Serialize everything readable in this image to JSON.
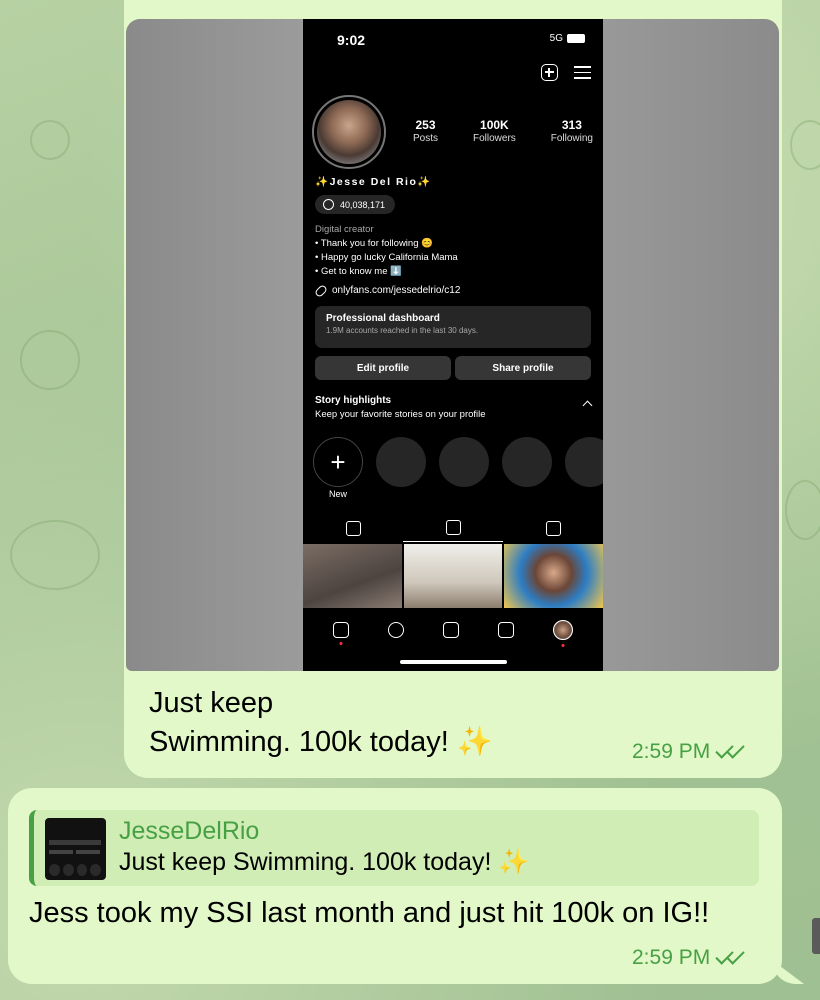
{
  "chat": {
    "message1": {
      "text_line1": "Just keep",
      "text_line2": "Swimming. 100k today! ✨",
      "time": "2:59 PM",
      "screenshot": {
        "status": {
          "time": "9:02",
          "network": "5G"
        },
        "profile": {
          "name": "✨Jesse Del Rio✨",
          "threads_count": "40,038,171",
          "stats": [
            {
              "value": "253",
              "label": "Posts"
            },
            {
              "value": "100K",
              "label": "Followers"
            },
            {
              "value": "313",
              "label": "Following"
            }
          ],
          "bio": {
            "category": "Digital creator",
            "lines": [
              "• Thank you for following 😊",
              "• Happy go lucky California Mama",
              "• Get to know me ⬇️"
            ]
          },
          "link": "onlyfans.com/jessedelrio/c12",
          "dashboard": {
            "title": "Professional dashboard",
            "subtitle": "1.9M accounts reached in the last 30 days."
          },
          "buttons": {
            "edit": "Edit profile",
            "share": "Share profile"
          },
          "highlights": {
            "title": "Story highlights",
            "subtitle": "Keep your favorite stories on your profile",
            "new_label": "New"
          }
        }
      }
    },
    "message2": {
      "reply": {
        "name": "JesseDelRio",
        "text": "Just keep Swimming. 100k today! ✨"
      },
      "text": "Jess took my SSI last month and just hit 100k on IG!!",
      "time": "2:59 PM"
    }
  },
  "colors": {
    "bubble": "#e2f8c8",
    "accent": "#48a045",
    "wallpaper": "#a9c79a"
  },
  "icons": [
    "plus-box-icon",
    "menu-icon",
    "threads-icon",
    "link-icon",
    "grid-icon",
    "reels-icon",
    "tagged-icon",
    "home-icon",
    "search-icon",
    "create-icon",
    "read-receipt-icon"
  ]
}
